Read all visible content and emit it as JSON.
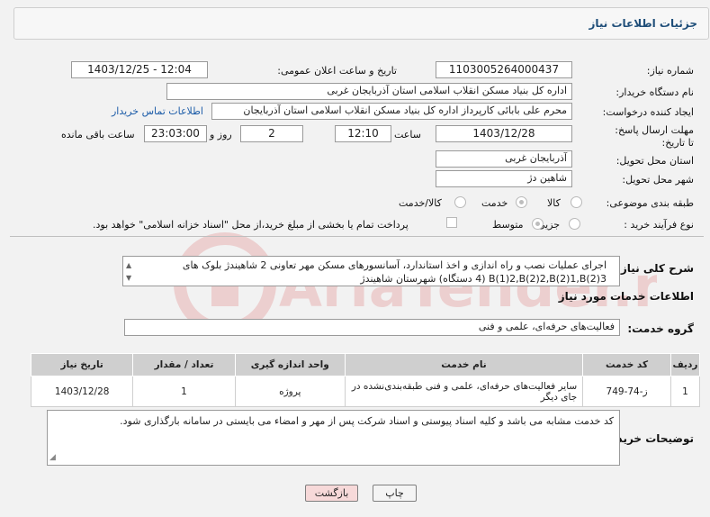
{
  "panel": {
    "title": "جزئیات اطلاعات نیاز"
  },
  "need_number": {
    "label": "شماره نیاز:",
    "value": "1103005264000437"
  },
  "announce": {
    "label": "تاریخ و ساعت اعلان عمومی:",
    "value": "1403/12/25 - 12:04"
  },
  "buyer": {
    "label": "نام دستگاه خریدار:",
    "value": "اداره کل بنیاد مسکن انقلاب اسلامی استان آذربایجان غربی"
  },
  "creator": {
    "label": "ایجاد کننده درخواست:",
    "value": "محرم علی بابائی کارپرداز اداره کل بنیاد مسکن انقلاب اسلامی استان آذربایجان",
    "contact_link": "اطلاعات تماس خریدار"
  },
  "deadline": {
    "label": "مهلت ارسال پاسخ: تا تاریخ:",
    "date": "1403/12/28",
    "time_label": "ساعت",
    "time": "12:10",
    "days": "2",
    "days_label": "روز و",
    "remaining": "23:03:00",
    "remaining_label": "ساعت باقی مانده"
  },
  "province": {
    "label": "استان محل تحویل:",
    "value": "آذربایجان غربی"
  },
  "city": {
    "label": "شهر محل تحویل:",
    "value": "شاهین دژ"
  },
  "category": {
    "label": "طبقه بندی موضوعی:",
    "options": [
      "کالا",
      "خدمت",
      "کالا/خدمت"
    ],
    "selected": "خدمت"
  },
  "process": {
    "label": "نوع فرآیند خرید :",
    "options": [
      "جزیی",
      "متوسط"
    ],
    "selected": "متوسط",
    "payment_note": "پرداخت تمام یا بخشی از مبلغ خرید،از محل \"اسناد خزانه اسلامی\" خواهد بود."
  },
  "description": {
    "label": "شرح کلی نیاز:",
    "value": "اجرای عملیات نصب و راه اندازی و اخذ استاندارد، آسانسورهای مسکن مهر تعاونی 2 شاهیندژ بلوک های B(1)2,B(2)2,B(2)1,B(2)3 (4 دستگاه) شهرستان شاهیندژ"
  },
  "services_info": {
    "title": "اطلاعات خدمات مورد نیاز"
  },
  "service_group": {
    "label": "گروه خدمت:",
    "value": "فعالیت‌های حرفه‌ای، علمی و فنی"
  },
  "table": {
    "headers": [
      "ردیف",
      "کد خدمت",
      "نام خدمت",
      "واحد اندازه گیری",
      "تعداد / مقدار",
      "تاریخ نیاز"
    ],
    "rows": [
      [
        "1",
        "ز-74-749",
        "سایر فعالیت‌های حرفه‌ای، علمی و فنی طبقه‌بندی‌نشده در جای دیگر",
        "پروژه",
        "1",
        "1403/12/28"
      ]
    ]
  },
  "buyer_notes": {
    "label": "توضیحات خریدار:",
    "value": "کد خدمت مشابه می باشد و کلیه اسناد پیوستی و اسناد شرکت پس از مهر و امضاء می بایستی در سامانه بارگذاری شود."
  },
  "buttons": {
    "print": "چاپ",
    "back": "بازگشت"
  },
  "watermark": {
    "text": "AriaTender.neT"
  }
}
